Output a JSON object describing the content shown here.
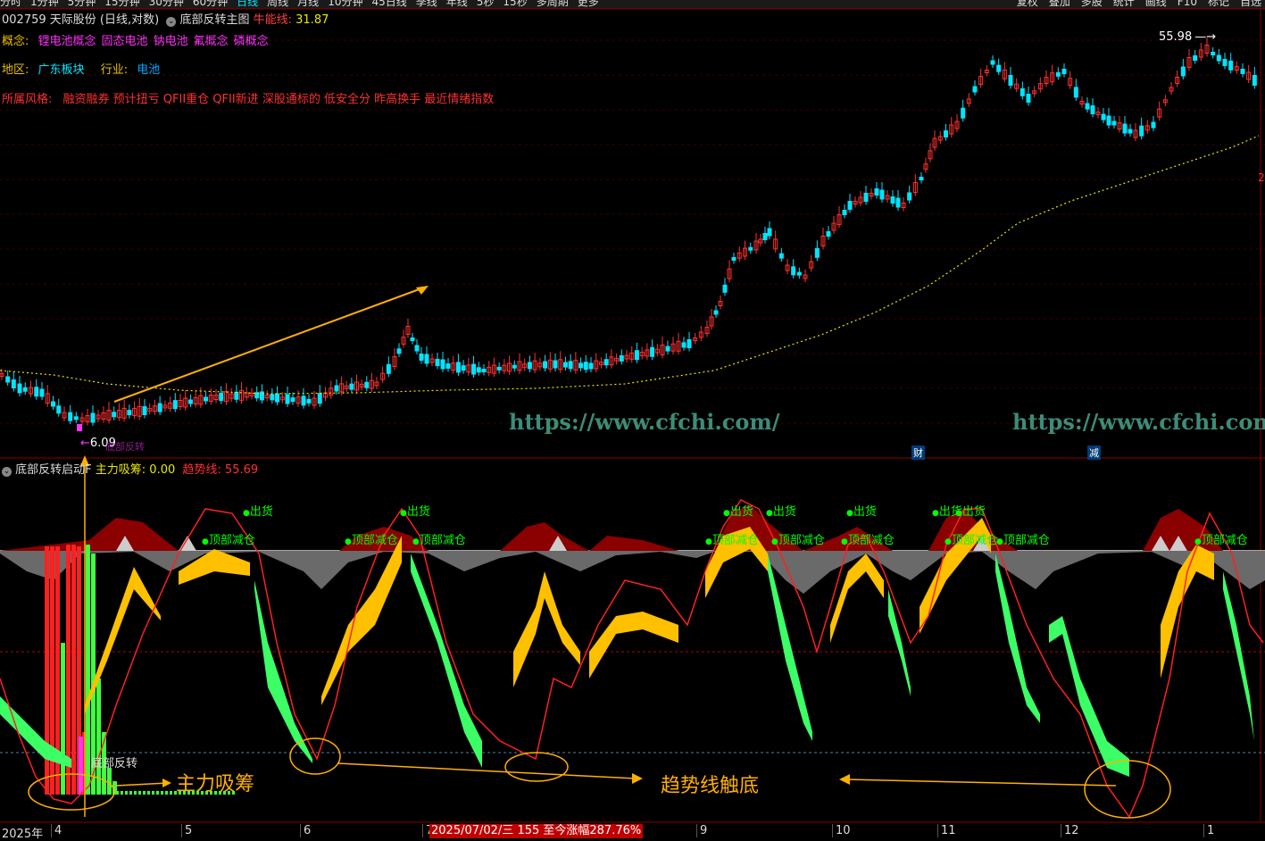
{
  "toolbar": {
    "periods": [
      "分时",
      "1分钟",
      "5分钟",
      "15分钟",
      "30分钟",
      "60分钟",
      "日线",
      "周线",
      "月线",
      "10分钟",
      "45日线",
      "季线",
      "年线",
      "5秒",
      "15秒",
      "多周期",
      "更多"
    ],
    "active_period": "日线",
    "right_buttons": [
      "复权",
      "叠加",
      "多股",
      "统计",
      "画线",
      "F10",
      "标记",
      "自选"
    ]
  },
  "main_header": {
    "stock": "002759 天际股份 (日线,对数)",
    "indicator": "底部反转主图",
    "line_label": "牛能线:",
    "line_value": "31.87"
  },
  "info": {
    "concept_label": "概念:",
    "concepts": [
      "锂电池概念",
      "固态电池",
      "钠电池",
      "氟概念",
      "磷概念"
    ],
    "region_label": "地区:",
    "region": "广东板块",
    "industry_label": "行业:",
    "industry": "电池",
    "style_label": "所属风格:",
    "styles": "融资融券 预计扭亏 QFII重仓 QFII新进 深股通标的 低安全分 昨高换手 最近情绪指数"
  },
  "price_marks": {
    "high": "55.98",
    "low": "6.09",
    "low_tag": "底部反转",
    "right_edge": "2"
  },
  "watermark": "https://www.cfchi.com/",
  "event_tags": [
    "财",
    "减"
  ],
  "sub_header": {
    "indicator": "底部反转启动F",
    "s1_label": "主力吸筹:",
    "s1_value": "0.00",
    "s2_label": "趋势线:",
    "s2_value": "55.69"
  },
  "signals": {
    "sell": "出货",
    "reduce": "顶部减仓",
    "bottom": "底部反转"
  },
  "annotations": {
    "accumulate": "主力吸筹",
    "trend_bottom": "趋势线触底"
  },
  "timeline": {
    "year": "2025年",
    "months": [
      "4",
      "5",
      "6",
      "7",
      "9",
      "10",
      "11",
      "12",
      "1"
    ],
    "cursor_info": "2025/07/02/三 155 至今涨幅287.76%"
  },
  "colors": {
    "up": "#ff3030",
    "down": "#00e5ff",
    "ma": "#e8e800",
    "yellow_band": "#ffc000",
    "green_band": "#3cff66",
    "dark_red": "#8b0000",
    "grey": "#666666",
    "signal": "#00ff00",
    "annotation": "#ffb000",
    "magenta": "#ff33ff"
  }
}
